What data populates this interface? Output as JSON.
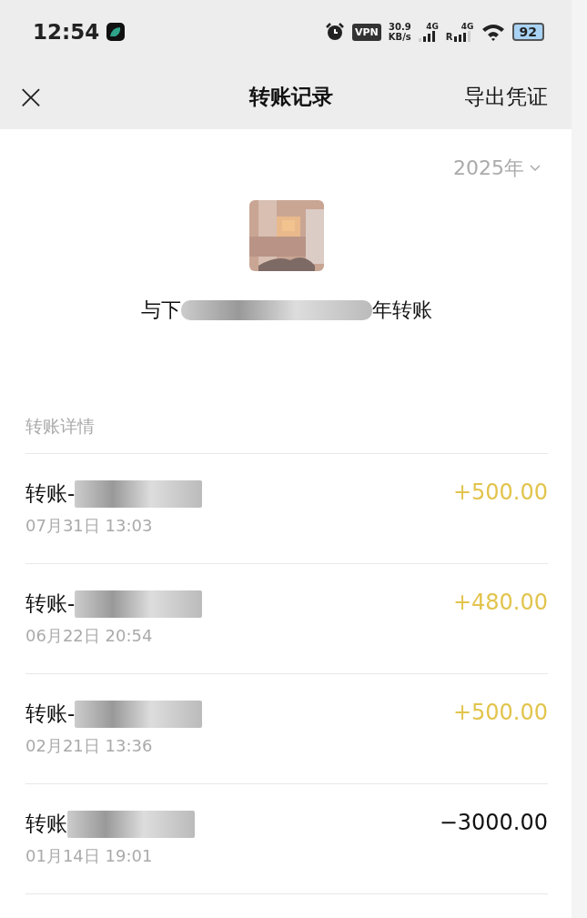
{
  "status_bar": {
    "time": "12:54",
    "vpn": "VPN",
    "speed_value": "30.9",
    "speed_unit": "KB/s",
    "network_1": "4G",
    "network_2": "4G",
    "roaming": "R",
    "battery": "92"
  },
  "nav": {
    "close": "×",
    "title": "转账记录",
    "action": "导出凭证"
  },
  "year_filter": "2025年",
  "contact": {
    "kind": "picture",
    "title_start": "与下",
    "title_end": "年转账"
  },
  "section_label": "转账详情",
  "transactions": [
    {
      "title": "转账-",
      "date": "07月31日 13:03",
      "amount": "+500.00",
      "kind": "income"
    },
    {
      "title": "转账-",
      "date": "06月22日 20:54",
      "amount": "+480.00",
      "kind": "income"
    },
    {
      "title": "转账-",
      "date": "02月21日 13:36",
      "amount": "+500.00",
      "kind": "income"
    },
    {
      "title": "转账",
      "date": "01月14日 19:01",
      "amount": "−3000.00",
      "kind": "expense"
    }
  ]
}
